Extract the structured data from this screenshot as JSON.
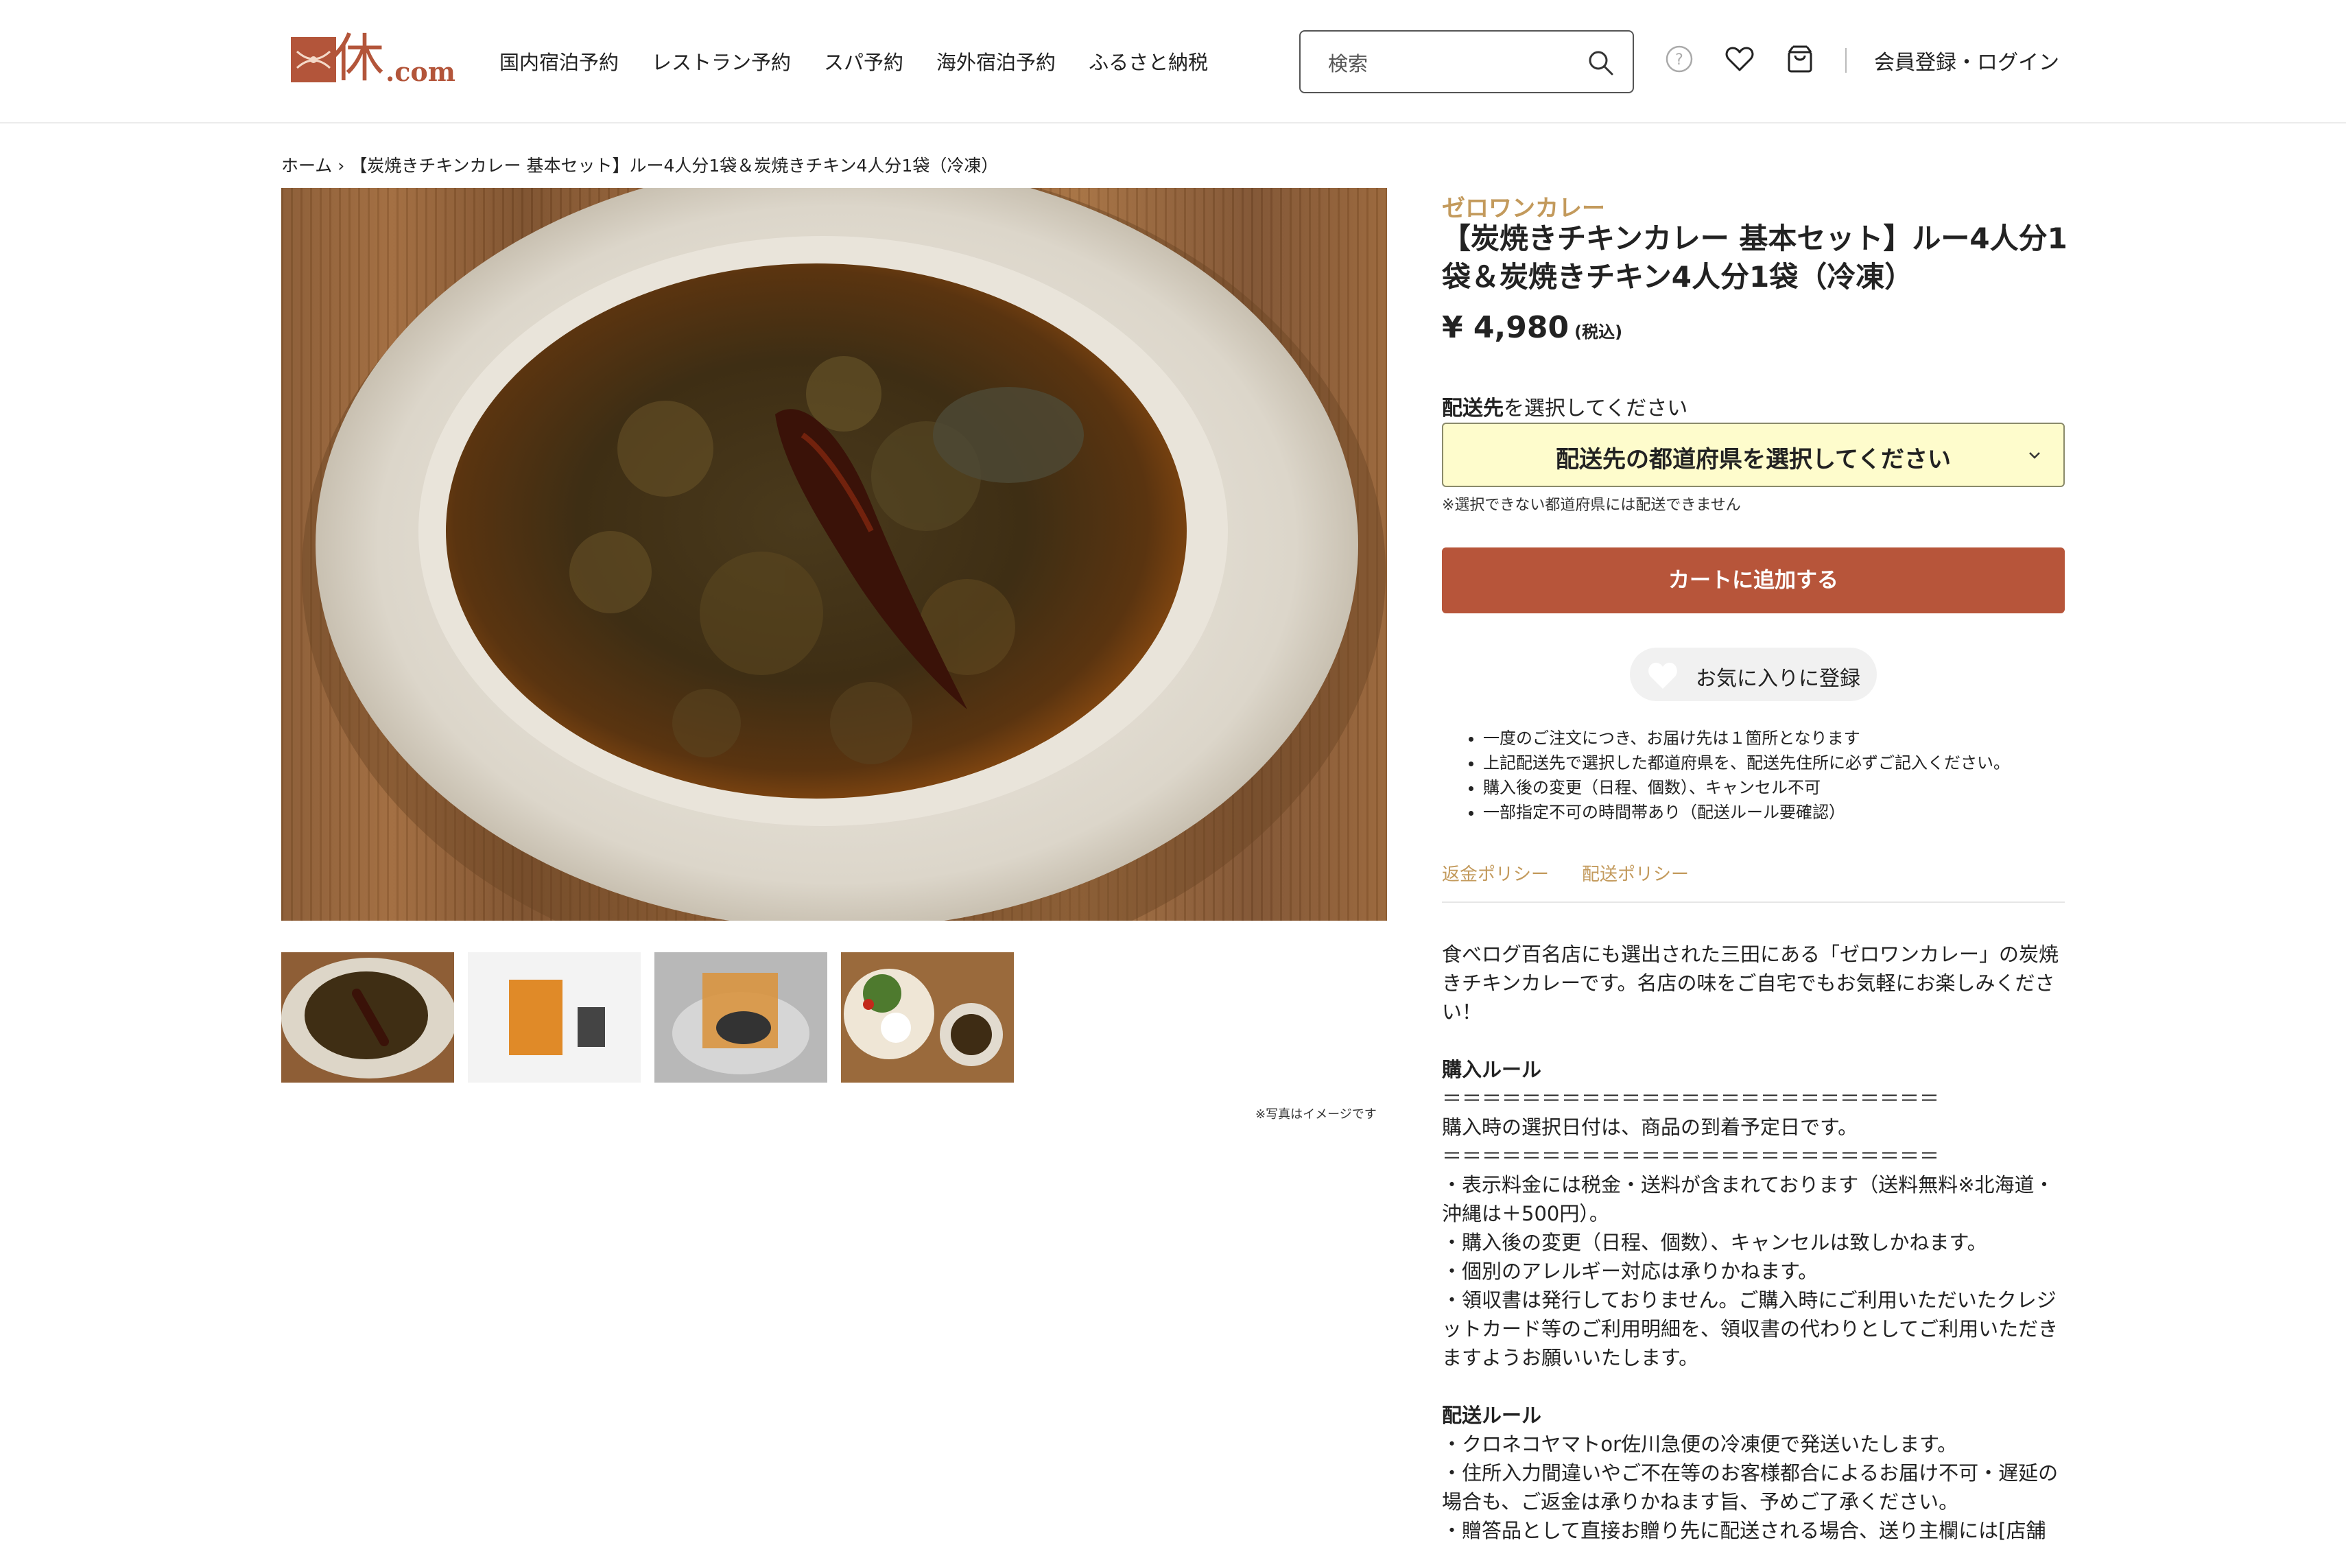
{
  "header": {
    "logo_text": "休.com",
    "logo_kanji": "休",
    "logo_suffix": ".com",
    "nav": [
      "国内宿泊予約",
      "レストラン予約",
      "スパ予約",
      "海外宿泊予約",
      "ふるさと納税"
    ],
    "search_placeholder": "検索",
    "login_label": "会員登録・ログイン",
    "icons": [
      "help-icon",
      "heart-icon",
      "cart-icon",
      "search-icon"
    ]
  },
  "breadcrumb": {
    "home": "ホーム",
    "separator": "›",
    "current": "【炭焼きチキンカレー 基本セット】ルー4人分1袋＆炭焼きチキン4人分1袋（冷凍）"
  },
  "gallery": {
    "thumb_count": 4,
    "note": "※写真はイメージです"
  },
  "product": {
    "brand": "ゼロワンカレー",
    "title": "【炭焼きチキンカレー 基本セット】ルー4人分1袋＆炭焼きチキン4人分1袋（冷凍）",
    "price": "¥ 4,980",
    "tax_label": "(税込)",
    "ship_label_bold": "配送先",
    "ship_label_rest": "を選択してください",
    "select_value": "配送先の都道府県を選択してください",
    "select_note": "※選択できない都道府県には配送できません",
    "cart_button": "カートに追加する",
    "favorite_button": "お気に入りに登録",
    "bullets": [
      "一度のご注文につき、お届け先は１箇所となります",
      "上記配送先で選択した都道府県を、配送先住所に必ずご記入ください。",
      "購入後の変更（日程、個数）、キャンセル不可",
      "一部指定不可の時間帯あり（配送ルール要確認）"
    ],
    "policies": [
      "返金ポリシー",
      "配送ポリシー"
    ]
  },
  "description": {
    "intro": "食べログ百名店にも選出された三田にある「ゼロワンカレー」の炭焼きチキンカレーです。名店の味をご自宅でもお気軽にお楽しみください！",
    "purchase_heading": "購入ルール",
    "rule_line": "＝＝＝＝＝＝＝＝＝＝＝＝＝＝＝＝＝＝＝＝＝＝＝＝＝",
    "purchase_date": "購入時の選択日付は、商品の到着予定日です。",
    "purchase_items": [
      "・表示料金には税金・送料が含まれております（送料無料※北海道・沖縄は＋500円）。",
      "・購入後の変更（日程、個数）、キャンセルは致しかねます。",
      "・個別のアレルギー対応は承りかねます。",
      "・領収書は発行しておりません。ご購入時にご利用いただいたクレジットカード等のご利用明細を、領収書の代わりとしてご利用いただきますようお願いいたします。"
    ],
    "shipping_heading": "配送ルール",
    "shipping_items": [
      "・クロネコヤマトor佐川急便の冷凍便で発送いたします。",
      "・住所入力間違いやご不在等のお客様都合によるお届け不可・遅延の場合も、ご返金は承りかねます旨、予めご了承ください。",
      "・贈答品として直接お贈り先に配送される場合、送り主欄には[店舗"
    ]
  },
  "colors": {
    "accent": "#b7553a",
    "brand_gold": "#c39a5c",
    "select_bg": "#fefccc"
  }
}
